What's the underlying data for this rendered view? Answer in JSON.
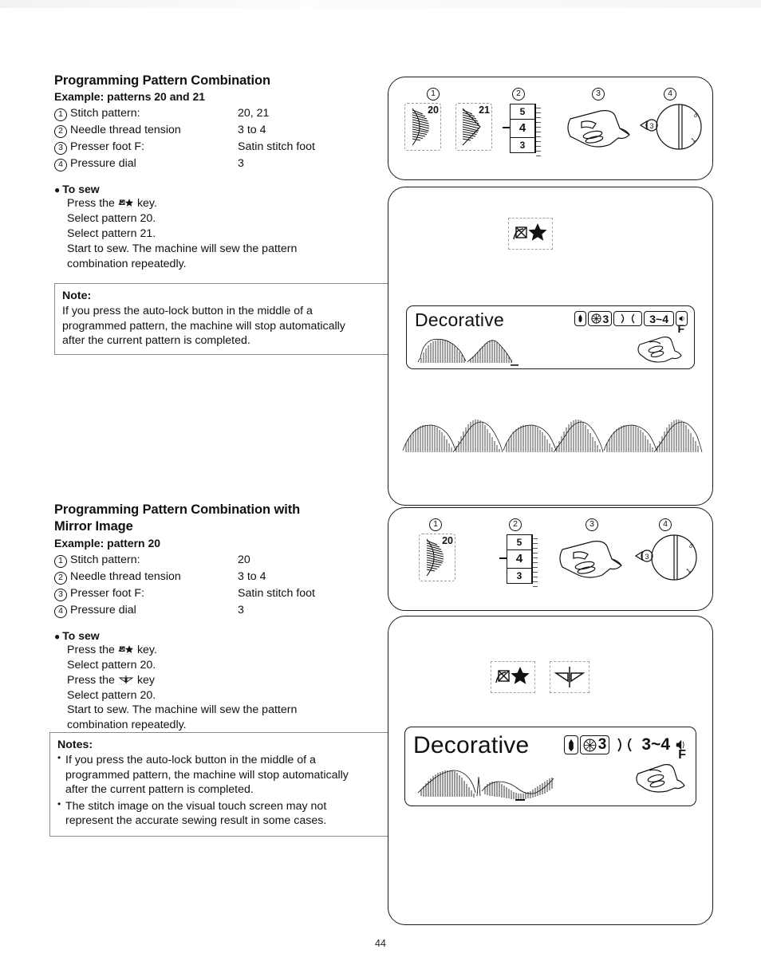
{
  "page": {
    "number": "44"
  },
  "section_one": {
    "title": "Programming Pattern Combination",
    "example": "Example: patterns 20 and 21",
    "specs": [
      {
        "num": "1",
        "label": "Stitch pattern:",
        "value": "20, 21"
      },
      {
        "num": "2",
        "label": "Needle thread tension",
        "value": "3 to 4"
      },
      {
        "num": "3",
        "label": "Presser foot F:",
        "value": "Satin stitch foot"
      },
      {
        "num": "4",
        "label": "Pressure dial",
        "value": "3"
      }
    ],
    "to_sew_heading": "To sew",
    "steps": [
      {
        "before": "Press the",
        "icon": "program-key-icon",
        "after": "key."
      },
      {
        "before": "Select pattern 20.",
        "icon": "",
        "after": ""
      },
      {
        "before": "Select pattern 21.",
        "icon": "",
        "after": ""
      },
      {
        "before": "Start to sew. The machine will sew the pattern",
        "icon": "",
        "after": ""
      },
      {
        "before": "combination repeatedly.",
        "icon": "",
        "after": ""
      }
    ],
    "note": {
      "title": "Note:",
      "lines": [
        "If you press the auto-lock button in the middle of a",
        "programmed pattern, the machine will stop automatically",
        "after the current pattern is completed."
      ]
    }
  },
  "section_two": {
    "title_line1": "Programming Pattern Combination with",
    "title_line2": "Mirror Image",
    "example": "Example: pattern 20",
    "specs": [
      {
        "num": "1",
        "label": "Stitch pattern:",
        "value": "20"
      },
      {
        "num": "2",
        "label": "Needle thread tension",
        "value": "3 to 4"
      },
      {
        "num": "3",
        "label": "Presser foot F:",
        "value": "Satin stitch foot"
      },
      {
        "num": "4",
        "label": "Pressure dial",
        "value": "3"
      }
    ],
    "to_sew_heading": "To sew",
    "steps": [
      {
        "before": "Press the",
        "icon": "program-key-icon",
        "after": "key."
      },
      {
        "before": "Select pattern 20.",
        "icon": "",
        "after": ""
      },
      {
        "before": "Press the",
        "icon": "mirror-key-icon",
        "after": "key"
      },
      {
        "before": "Select pattern 20.",
        "icon": "",
        "after": ""
      },
      {
        "before": "Start to sew. The machine will sew the pattern",
        "icon": "",
        "after": ""
      },
      {
        "before": "combination repeatedly.",
        "icon": "",
        "after": ""
      }
    ],
    "notes": {
      "title": "Notes:",
      "items": [
        [
          "If you press the auto-lock button in the middle of a",
          "programmed pattern, the machine will stop automatically",
          "after the current pattern is completed."
        ],
        [
          "The stitch image on the visual touch screen may not",
          "represent the accurate sewing result in some cases."
        ]
      ]
    }
  },
  "reference_panel_one": {
    "markers": [
      "1",
      "2",
      "3",
      "4"
    ],
    "patterns": [
      "20",
      "21"
    ],
    "tension_scale": [
      "5",
      "4",
      "3"
    ],
    "tension_selected": "4",
    "presser_foot_label": "F",
    "pressure_dial_value": "3"
  },
  "reference_panel_two": {
    "markers": [
      "1",
      "2",
      "3",
      "4"
    ],
    "patterns": [
      "20"
    ],
    "tension_scale": [
      "5",
      "4",
      "3"
    ],
    "tension_selected": "4",
    "presser_foot_label": "F",
    "pressure_dial_value": "3"
  },
  "screen_panel_one": {
    "keys": [
      "program-key-icon"
    ],
    "lcd": {
      "title": "Decorative",
      "needle_icon": "needle-icon",
      "tension_icon": "tension-dial-icon",
      "tension_value": "3",
      "width_icon": "stitch-width-icon",
      "width_value": "3~4",
      "speed_icon": "speed-icon",
      "foot_letter": "F"
    }
  },
  "screen_panel_two": {
    "keys": [
      "program-key-icon",
      "mirror-key-icon"
    ],
    "lcd": {
      "title": "Decorative",
      "needle_icon": "needle-icon",
      "tension_icon": "tension-dial-icon",
      "tension_value": "3",
      "width_icon": "stitch-width-icon",
      "width_value": "3~4",
      "speed_icon": "speed-icon",
      "foot_letter": "F"
    }
  }
}
